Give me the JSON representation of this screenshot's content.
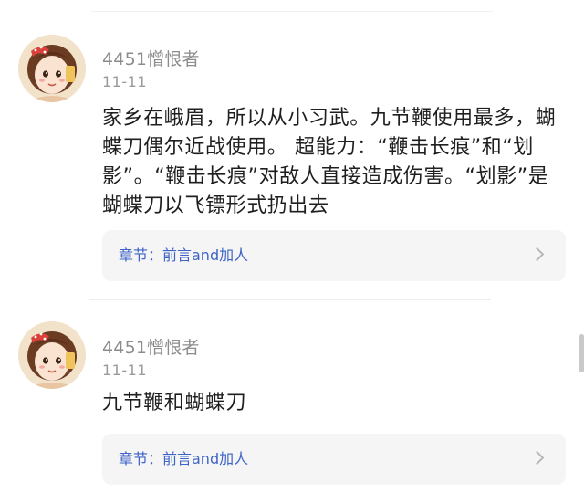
{
  "comments": [
    {
      "username": "4451憎恨者",
      "date": "11-11",
      "text": "家乡在峨眉，所以从小习武。九节鞭使用最多，蝴蝶刀偶尔近战使用。 超能力：“鞭击长痕”和“划影”。“鞭击长痕”对敌人直接造成伤害。“划影”是蝴蝶刀以飞镖形式扔出去",
      "chapter_label": "章节：前言and加人"
    },
    {
      "username": "4451憎恨者",
      "date": "11-11",
      "text": "九节鞭和蝴蝶刀",
      "chapter_label": "章节：前言and加人"
    }
  ],
  "icons": {
    "avatar": "cartoon-girl-avatar",
    "chapter_arrow": "chevron-right-icon"
  },
  "colors": {
    "chapter_link": "#3e64c8",
    "meta_text": "#8c8c8c",
    "card_bg": "#f5f5f5"
  }
}
